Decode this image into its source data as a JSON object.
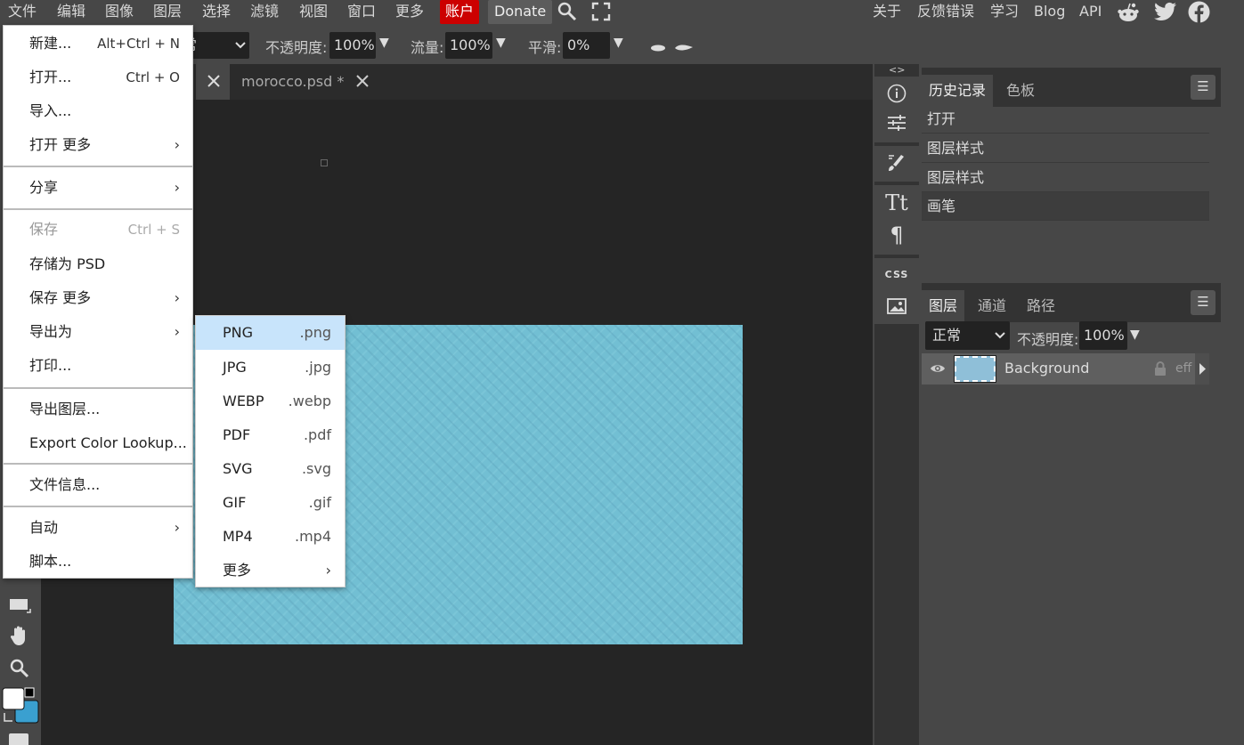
{
  "menubar": {
    "items": [
      "文件",
      "编辑",
      "图像",
      "图层",
      "选择",
      "滤镜",
      "视图",
      "窗口",
      "更多"
    ],
    "account": "账户",
    "donate": "Donate",
    "right_items": [
      "关于",
      "反馈错误",
      "学习",
      "Blog",
      "API"
    ],
    "icons": [
      "search-icon",
      "fullscreen-icon",
      "reddit-icon",
      "twitter-icon",
      "facebook-icon"
    ]
  },
  "options": {
    "blend_partial": "常",
    "opacity_label": "不透明度:",
    "opacity_value": "100%",
    "flow_label": "流量:",
    "flow_value": "100%",
    "smooth_label": "平滑:",
    "smooth_value": "0%"
  },
  "tabs": [
    {
      "label": "morocco.psd *"
    }
  ],
  "file_menu": {
    "items": [
      {
        "label": "新建...",
        "shortcut": "Alt+Ctrl + N"
      },
      {
        "label": "打开...",
        "shortcut": "Ctrl + O"
      },
      {
        "label": "导入..."
      },
      {
        "label": "打开 更多"
      },
      {
        "label": "分享"
      },
      {
        "label": "保存",
        "shortcut": "Ctrl + S"
      },
      {
        "label": "存储为 PSD"
      },
      {
        "label": "保存 更多"
      },
      {
        "label": "导出为"
      },
      {
        "label": "打印..."
      },
      {
        "label": "导出图层..."
      },
      {
        "label": "Export Color Lookup..."
      },
      {
        "label": "文件信息..."
      },
      {
        "label": "自动"
      },
      {
        "label": "脚本..."
      }
    ]
  },
  "export_submenu": {
    "items": [
      {
        "label": "PNG",
        "ext": ".png"
      },
      {
        "label": "JPG",
        "ext": ".jpg"
      },
      {
        "label": "WEBP",
        "ext": ".webp"
      },
      {
        "label": "PDF",
        "ext": ".pdf"
      },
      {
        "label": "SVG",
        "ext": ".svg"
      },
      {
        "label": "GIF",
        "ext": ".gif"
      },
      {
        "label": "MP4",
        "ext": ".mp4"
      },
      {
        "label": "更多",
        "ext": ""
      }
    ]
  },
  "icon_column": {
    "collapse_left": "<>",
    "collapse_right": "><",
    "css_label": "CSS"
  },
  "history_panel": {
    "tabs": [
      "历史记录",
      "色板"
    ],
    "items": [
      "打开",
      "图层样式",
      "图层样式",
      "画笔"
    ]
  },
  "layers_panel": {
    "tabs": [
      "图层",
      "通道",
      "路径"
    ],
    "blend_mode": "正常",
    "opacity_label": "不透明度:",
    "opacity_value": "100%",
    "layer_name": "Background",
    "fx_label": "eff"
  },
  "colors": {
    "canvas": "#72bfd3",
    "account": "#cc0000",
    "highlight": "#c8e4fb",
    "background_color": "#3aa0d0"
  }
}
